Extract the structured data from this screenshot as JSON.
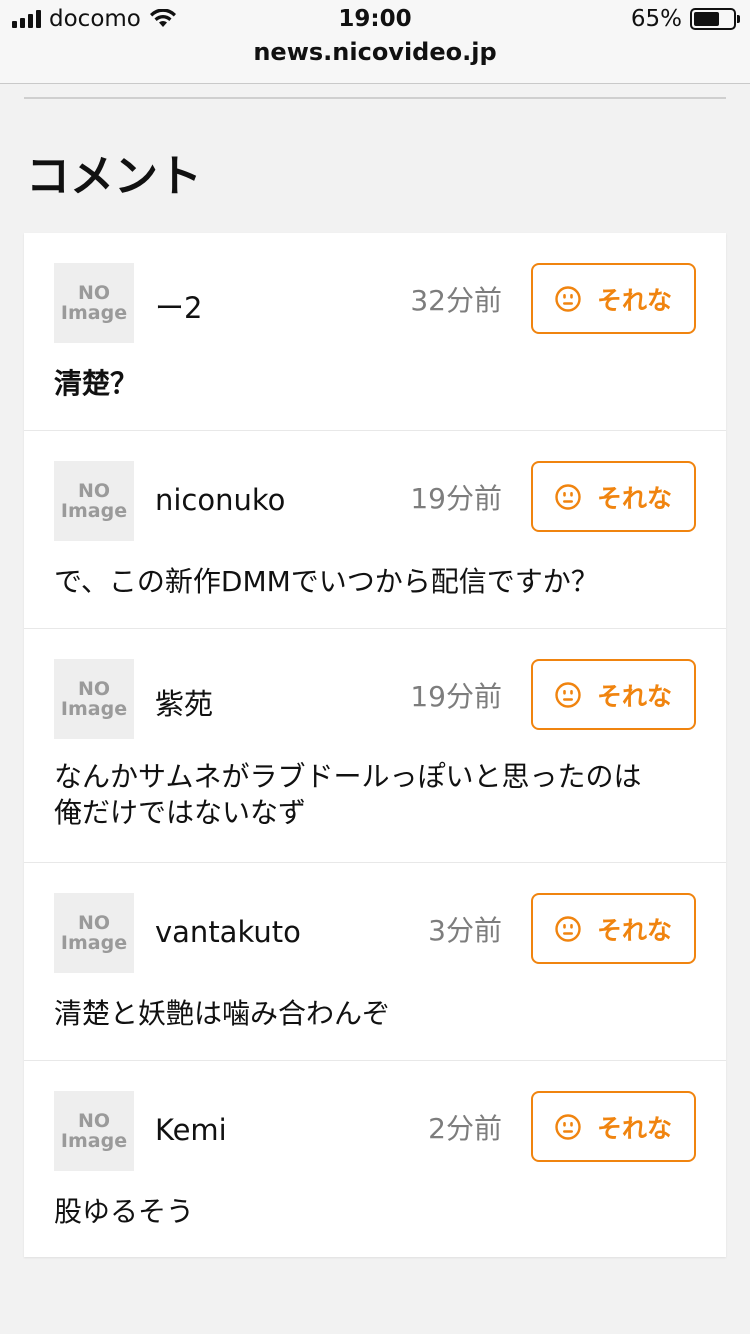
{
  "status_bar": {
    "carrier": "docomo",
    "time": "19:00",
    "battery_percent": "65%",
    "battery_level": 0.65,
    "url": "news.nicovideo.jp"
  },
  "section": {
    "title": "コメント"
  },
  "comments": [
    {
      "avatar_line1": "NO",
      "avatar_line2": "Image",
      "username": "ー2",
      "time": "32分前",
      "reaction_label": "それな",
      "text": "清楚？"
    },
    {
      "avatar_line1": "NO",
      "avatar_line2": "Image",
      "username": "niconuko",
      "time": "19分前",
      "reaction_label": "それな",
      "text": "で、この新作DMMでいつから配信ですか？"
    },
    {
      "avatar_line1": "NO",
      "avatar_line2": "Image",
      "username": "紫苑",
      "time": "19分前",
      "reaction_label": "それな",
      "text": "なんかサムネがラブドールっぽいと思ったのは\n俺だけではないなず"
    },
    {
      "avatar_line1": "NO",
      "avatar_line2": "Image",
      "username": "vantakuto",
      "time": "3分前",
      "reaction_label": "それな",
      "text": "清楚と妖艶は噛み合わんぞ"
    },
    {
      "avatar_line1": "NO",
      "avatar_line2": "Image",
      "username": "Kemi",
      "time": "2分前",
      "reaction_label": "それな",
      "text": "股ゆるそう"
    }
  ],
  "colors": {
    "accent": "#f0840f",
    "time_text": "#7d7d7d",
    "avatar_bg": "#eeeeee"
  },
  "icons": {
    "reaction": "neutral-face-icon",
    "wifi": "wifi-icon",
    "signal": "signal-bars-icon",
    "battery": "battery-icon"
  }
}
